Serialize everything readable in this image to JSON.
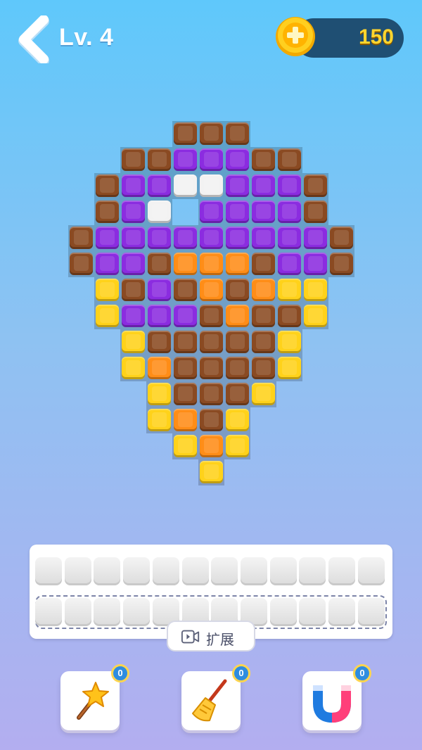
{
  "header": {
    "level_label": "Lv. 4",
    "coins": "150"
  },
  "colors": {
    "background_top": "#5fc8fb",
    "background_bottom": "#b3aef0",
    "B": "#8a4a22",
    "P": "#8b2ce0",
    "W": "#f2f2f2",
    "O": "#ff8d17",
    "Y": "#ffd21a"
  },
  "board": {
    "rows": [
      "....BBB....",
      "..BBPPPBB..",
      ".BPPWWPPPB.",
      ".BPW.PPPPB.",
      "BPPPPPPPPPB",
      "BPPBOOOBPPB",
      ".YBPBOBOYY.",
      ".YPPPBOBBY.",
      "..YBBBBBY..",
      "..YOBBBBY..",
      "...YBBBY...",
      "...YOBY....",
      "....YOY....",
      ".....Y....."
    ]
  },
  "tray": {
    "slot_rows": 2,
    "slots_per_row": 12,
    "expand_label": "扩展"
  },
  "boosters": [
    {
      "name": "magic-wand",
      "count": "0"
    },
    {
      "name": "broom",
      "count": "0"
    },
    {
      "name": "magnet",
      "count": "0"
    }
  ]
}
